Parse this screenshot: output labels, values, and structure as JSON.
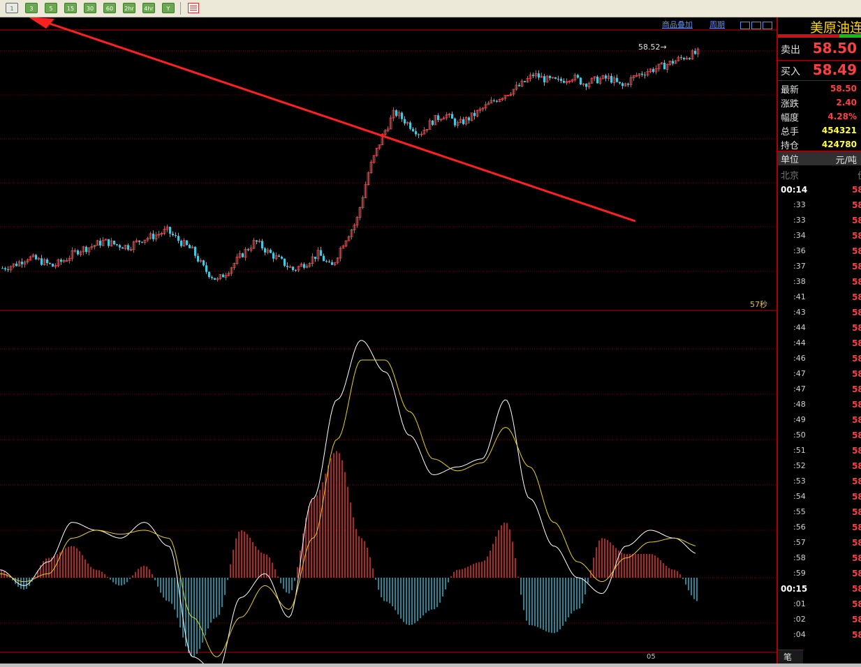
{
  "toolbar": {
    "periods": [
      "1",
      "3",
      "5",
      "15",
      "30",
      "60",
      "2hr",
      "4hr",
      "Y"
    ],
    "active_period": "1",
    "calendar_icon": "calendar-icon"
  },
  "chart_header": {
    "overlay_link": "商品叠加",
    "period_link": "周期",
    "window_icons": [
      "shrink-icon",
      "expand-icon",
      "layout-icon"
    ]
  },
  "chart": {
    "peak_label": "58.52→",
    "countdown": "57秒",
    "x_label": "05",
    "colors": {
      "up": "#ff4040",
      "down": "#40c8e0",
      "grid": "#800000",
      "dif": "#ffffff",
      "dea": "#e8d020",
      "arrow": "#ff2020"
    }
  },
  "chart_data": [
    {
      "type": "candlestick",
      "title": "",
      "y_trend": [
        56.1,
        56.14,
        56.22,
        56.18,
        56.12,
        56.2,
        56.3,
        56.34,
        56.4,
        56.36,
        56.34,
        56.42,
        56.46,
        56.52,
        56.4,
        56.3,
        56.08,
        55.96,
        56.1,
        56.26,
        56.4,
        56.28,
        56.18,
        56.08,
        56.16,
        56.26,
        56.1,
        56.4,
        56.62,
        57.2,
        57.56,
        57.84,
        57.72,
        57.6,
        57.74,
        57.82,
        57.7,
        57.78,
        57.88,
        57.98,
        58.06,
        58.14,
        58.26,
        58.2,
        58.18,
        58.24,
        58.16,
        58.2,
        58.22,
        58.12,
        58.24,
        58.3,
        58.34,
        58.4,
        58.46,
        58.5
      ],
      "last_high": 58.52
    },
    {
      "type": "line",
      "title": "",
      "series": [
        {
          "values": [
            0.02,
            -0.02,
            0.04,
            0.14,
            0.12,
            0.1,
            0.14,
            0.08,
            -0.2,
            -0.24,
            -0.05,
            0.01,
            -0.1,
            0.2,
            0.45,
            0.6,
            0.52,
            0.36,
            0.26,
            0.28,
            0.3,
            0.45,
            0.2,
            0.08,
            0.0,
            -0.04,
            0.08,
            0.12,
            0.1,
            0.06
          ]
        },
        {
          "values": [
            0.01,
            -0.01,
            0.01,
            0.1,
            0.12,
            0.11,
            0.12,
            0.1,
            -0.1,
            -0.2,
            -0.1,
            -0.02,
            -0.08,
            0.1,
            0.35,
            0.55,
            0.55,
            0.42,
            0.3,
            0.27,
            0.29,
            0.38,
            0.28,
            0.14,
            0.04,
            -0.01,
            0.05,
            0.09,
            0.1,
            0.08
          ]
        }
      ],
      "histogram": [
        0.02,
        -0.03,
        0.05,
        0.08,
        0.02,
        -0.02,
        0.03,
        -0.06,
        -0.2,
        -0.1,
        0.12,
        0.06,
        -0.04,
        0.2,
        0.32,
        0.1,
        -0.06,
        -0.12,
        -0.08,
        0.02,
        0.04,
        0.14,
        -0.12,
        -0.14,
        -0.08,
        0.1,
        0.06,
        0.06,
        0.02,
        -0.06
      ]
    }
  ],
  "side_panel": {
    "title": "美原油连",
    "sell_label": "卖出",
    "sell_price": "58.50",
    "buy_label": "买入",
    "buy_price": "58.49",
    "stats": [
      {
        "label": "最新",
        "value": "58.50",
        "color": "#ff4040"
      },
      {
        "label": "涨跌",
        "value": "2.40",
        "color": "#ff4040"
      },
      {
        "label": "幅度",
        "value": "4.28%",
        "color": "#ff4040"
      },
      {
        "label": "总手",
        "value": "454321",
        "color": "#ffff40"
      },
      {
        "label": "持仓",
        "value": "424780",
        "color": "#ffff40"
      }
    ],
    "unit_label": "单位",
    "unit_value": "元/吨",
    "tick_header": "北京",
    "tick_header_price": "价",
    "ticks": [
      {
        "time": "00:14",
        "price": "58",
        "hour": true
      },
      {
        "time": ":33",
        "price": "58"
      },
      {
        "time": ":33",
        "price": "58"
      },
      {
        "time": ":34",
        "price": "58"
      },
      {
        "time": ":36",
        "price": "58"
      },
      {
        "time": ":37",
        "price": "58"
      },
      {
        "time": ":38",
        "price": "58"
      },
      {
        "time": ":41",
        "price": "58"
      },
      {
        "time": ":43",
        "price": "58"
      },
      {
        "time": ":44",
        "price": "58"
      },
      {
        "time": ":44",
        "price": "58"
      },
      {
        "time": ":46",
        "price": "58"
      },
      {
        "time": ":47",
        "price": "58"
      },
      {
        "time": ":47",
        "price": "58"
      },
      {
        "time": ":48",
        "price": "58"
      },
      {
        "time": ":49",
        "price": "58"
      },
      {
        "time": ":50",
        "price": "58"
      },
      {
        "time": ":51",
        "price": "58"
      },
      {
        "time": ":52",
        "price": "58"
      },
      {
        "time": ":53",
        "price": "58"
      },
      {
        "time": ":54",
        "price": "58"
      },
      {
        "time": ":55",
        "price": "58"
      },
      {
        "time": ":56",
        "price": "58"
      },
      {
        "time": ":57",
        "price": "58"
      },
      {
        "time": ":58",
        "price": "58"
      },
      {
        "time": ":59",
        "price": "58"
      },
      {
        "time": "00:15",
        "price": "58",
        "hour": true
      },
      {
        "time": ":01",
        "price": "58"
      },
      {
        "time": ":02",
        "price": "58"
      },
      {
        "time": ":04",
        "price": "58"
      }
    ],
    "tab_label": "笔"
  }
}
